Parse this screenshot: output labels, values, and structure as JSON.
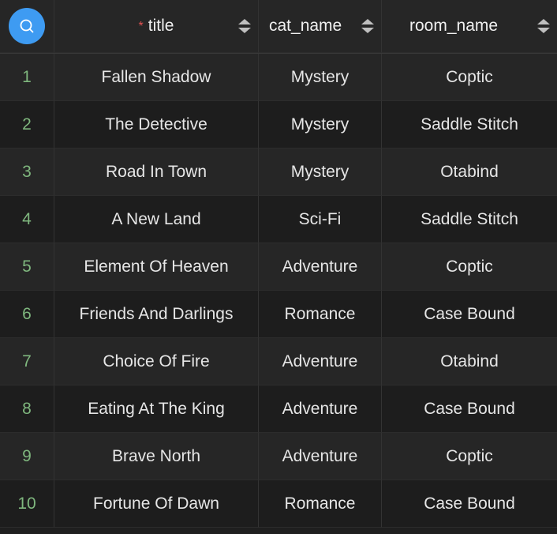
{
  "header": {
    "search_icon": "search-icon",
    "accent_color": "#3e9bf2",
    "required_marker": "*",
    "columns": [
      "title",
      "cat_name",
      "room_name"
    ]
  },
  "rows": [
    {
      "index": "1",
      "title": "Fallen Shadow",
      "cat_name": "Mystery",
      "room_name": "Coptic"
    },
    {
      "index": "2",
      "title": "The Detective",
      "cat_name": "Mystery",
      "room_name": "Saddle Stitch"
    },
    {
      "index": "3",
      "title": "Road In Town",
      "cat_name": "Mystery",
      "room_name": "Otabind"
    },
    {
      "index": "4",
      "title": "A New Land",
      "cat_name": "Sci-Fi",
      "room_name": "Saddle Stitch"
    },
    {
      "index": "5",
      "title": "Element Of Heaven",
      "cat_name": "Adventure",
      "room_name": "Coptic"
    },
    {
      "index": "6",
      "title": "Friends And Darlings",
      "cat_name": "Romance",
      "room_name": "Case Bound"
    },
    {
      "index": "7",
      "title": "Choice Of Fire",
      "cat_name": "Adventure",
      "room_name": "Otabind"
    },
    {
      "index": "8",
      "title": "Eating At The King",
      "cat_name": "Adventure",
      "room_name": "Case Bound"
    },
    {
      "index": "9",
      "title": "Brave North",
      "cat_name": "Adventure",
      "room_name": "Coptic"
    },
    {
      "index": "10",
      "title": "Fortune Of Dawn",
      "cat_name": "Romance",
      "room_name": "Case Bound"
    }
  ]
}
